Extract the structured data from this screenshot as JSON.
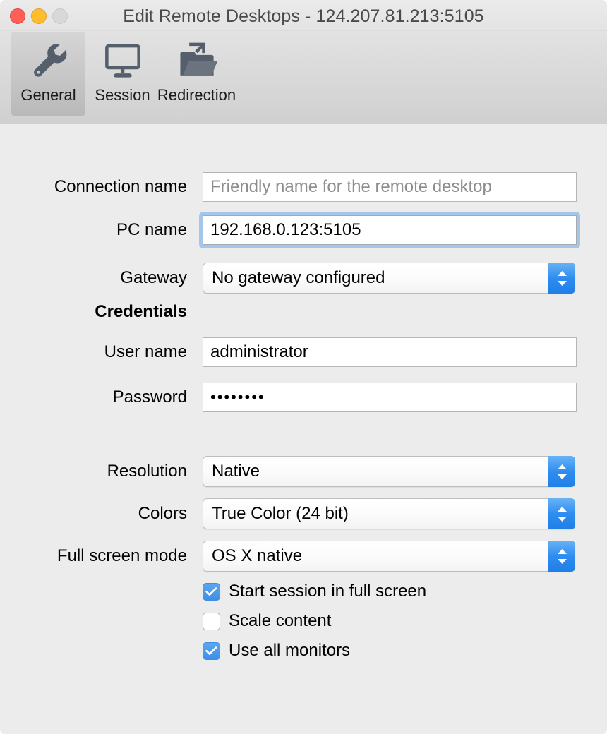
{
  "window": {
    "title": "Edit Remote Desktops - 124.207.81.213:5105",
    "controls": {
      "close": "close-button",
      "minimize": "minimize-button",
      "zoom": "zoom-button"
    }
  },
  "toolbar": {
    "items": [
      {
        "label": "General",
        "icon": "wrench-icon",
        "selected": true
      },
      {
        "label": "Session",
        "icon": "monitor-icon",
        "selected": false
      },
      {
        "label": "Redirection",
        "icon": "folder-arrow-icon",
        "selected": false
      }
    ]
  },
  "form": {
    "connection_name": {
      "label": "Connection name",
      "value": "",
      "placeholder": "Friendly name for the remote desktop"
    },
    "pc_name": {
      "label": "PC name",
      "value": "192.168.0.123:5105",
      "focused": true
    },
    "gateway": {
      "label": "Gateway",
      "value": "No gateway configured"
    },
    "credentials_heading": "Credentials",
    "user_name": {
      "label": "User name",
      "value": "administrator"
    },
    "password": {
      "label": "Password",
      "value": "••••••••"
    },
    "resolution": {
      "label": "Resolution",
      "value": "Native"
    },
    "colors": {
      "label": "Colors",
      "value": "True Color (24 bit)"
    },
    "full_screen_mode": {
      "label": "Full screen mode",
      "value": "OS X native"
    },
    "checkboxes": [
      {
        "label": "Start session in full screen",
        "checked": true
      },
      {
        "label": "Scale content",
        "checked": false
      },
      {
        "label": "Use all monitors",
        "checked": true
      }
    ]
  },
  "colors": {
    "accent_blue": "#2f8df0",
    "checkbox_blue": "#3f8fe6",
    "focus_ring": "#a4c6ea",
    "close_red": "#ff5f57",
    "minimize_yellow": "#ffbd2e",
    "zoom_disabled": "#d8d8d8",
    "window_bg": "#ececec",
    "toolbar_bg": "#d8d8d8",
    "icon_gray": "#555f६b"
  }
}
